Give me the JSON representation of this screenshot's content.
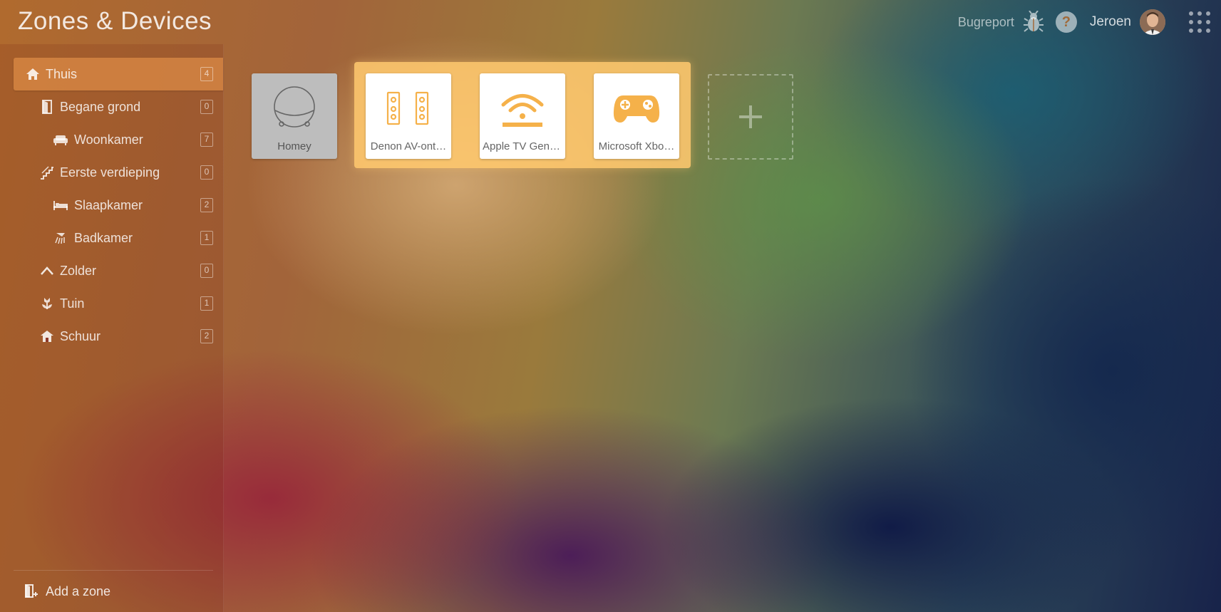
{
  "header": {
    "title": "Zones & Devices",
    "bugreport_label": "Bugreport",
    "help_label": "?",
    "username": "Jeroen"
  },
  "sidebar": {
    "zones": [
      {
        "name": "Thuis",
        "count": "4",
        "icon": "home-icon",
        "active": true
      },
      {
        "name": "Begane grond",
        "count": "0",
        "icon": "door-icon"
      },
      {
        "name": "Woonkamer",
        "count": "7",
        "icon": "sofa-icon"
      },
      {
        "name": "Eerste verdieping",
        "count": "0",
        "icon": "stairs-icon"
      },
      {
        "name": "Slaapkamer",
        "count": "2",
        "icon": "bed-icon"
      },
      {
        "name": "Badkamer",
        "count": "1",
        "icon": "shower-icon"
      },
      {
        "name": "Zolder",
        "count": "0",
        "icon": "attic-icon"
      },
      {
        "name": "Tuin",
        "count": "1",
        "icon": "flower-icon"
      },
      {
        "name": "Schuur",
        "count": "2",
        "icon": "shed-icon"
      }
    ],
    "add_zone_label": "Add a zone"
  },
  "devices": [
    {
      "name": "Homey",
      "icon": "homey-icon",
      "style": "dimmed"
    },
    {
      "name": "Denon AV-ont…",
      "icon": "speakers-icon"
    },
    {
      "name": "Apple TV Gen …",
      "icon": "apple-tv-icon"
    },
    {
      "name": "Microsoft Xbo…",
      "icon": "gamepad-icon"
    }
  ],
  "colors": {
    "accent": "#f5b14a",
    "active_zone": "#de8c46",
    "card": "#ffffff",
    "card_dimmed": "#bdbdbd"
  }
}
